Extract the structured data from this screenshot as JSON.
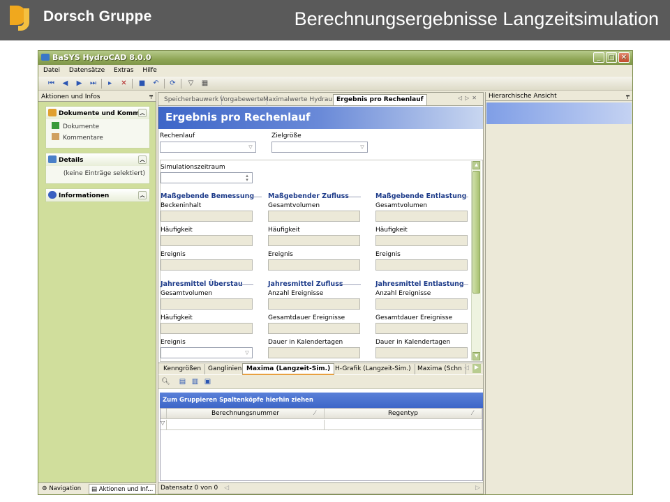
{
  "banner": {
    "logo": "Dorsch Gruppe",
    "title": "Berechnungsergebnisse Langzeitsimulation"
  },
  "window": {
    "title": "BaSYS HydroCAD 8.0.0"
  },
  "menu": [
    "Datei",
    "Datensätze",
    "Extras",
    "Hilfe"
  ],
  "left_pane": {
    "header": "Aktionen und Infos",
    "groups": [
      {
        "title": "Dokumente und Komme",
        "items": [
          "Dokumente",
          "Kommentare"
        ]
      },
      {
        "title": "Details",
        "items": [
          "(keine Einträge selektiert)"
        ]
      },
      {
        "title": "Informationen",
        "items": []
      }
    ],
    "bottom_tabs": [
      "Navigation",
      "Aktionen und Inf..."
    ]
  },
  "center": {
    "tabs": [
      "Speicherbauwerk",
      "Vorgabewerte",
      "Maximalwerte Hydraulik",
      "Ergebnis pro Rechenlauf"
    ],
    "heading": "Ergebnis pro Rechenlauf",
    "fields": {
      "rechenlauf": "Rechenlauf",
      "zielgroesse": "Zielgröße",
      "simzeitraum": "Simulationszeitraum"
    },
    "sections": [
      {
        "title": "Maßgebende Bemessung",
        "labels": [
          "Beckeninhalt",
          "Häufigkeit",
          "Ereignis"
        ]
      },
      {
        "title": "Maßgebender Zufluss",
        "labels": [
          "Gesamtvolumen",
          "Häufigkeit",
          "Ereignis"
        ]
      },
      {
        "title": "Maßgebende Entlastung",
        "labels": [
          "Gesamtvolumen",
          "Häufigkeit",
          "Ereignis"
        ]
      },
      {
        "title": "Jahresmittel Überstau",
        "labels": [
          "Gesamtvolumen",
          "Häufigkeit",
          "Ereignis"
        ]
      },
      {
        "title": "Jahresmittel Zufluss",
        "labels": [
          "Anzahl Ereignisse",
          "Gesamtdauer Ereignisse",
          "Dauer in Kalendertagen"
        ]
      },
      {
        "title": "Jahresmittel Entlastung",
        "labels": [
          "Anzahl Ereignisse",
          "Gesamtdauer Ereignisse",
          "Dauer in Kalendertagen"
        ]
      }
    ],
    "bottom_tabs": [
      "Kenngrößen",
      "Ganglinien",
      "Maxima (Langzeit-Sim.)",
      "H-Grafik (Langzeit-Sim.)",
      "Maxima (Schn"
    ],
    "group_hint": "Zum Gruppieren Spaltenköpfe hierhin ziehen",
    "columns": [
      "Berechnungsnummer",
      "Regentyp"
    ],
    "status": "Datensatz 0 von 0"
  },
  "right_pane": {
    "header": "Hierarchische Ansicht"
  },
  "colors": {
    "accent": "#3d66c8",
    "titlebar": "#8fa656",
    "left_pane": "#d0de9c"
  }
}
